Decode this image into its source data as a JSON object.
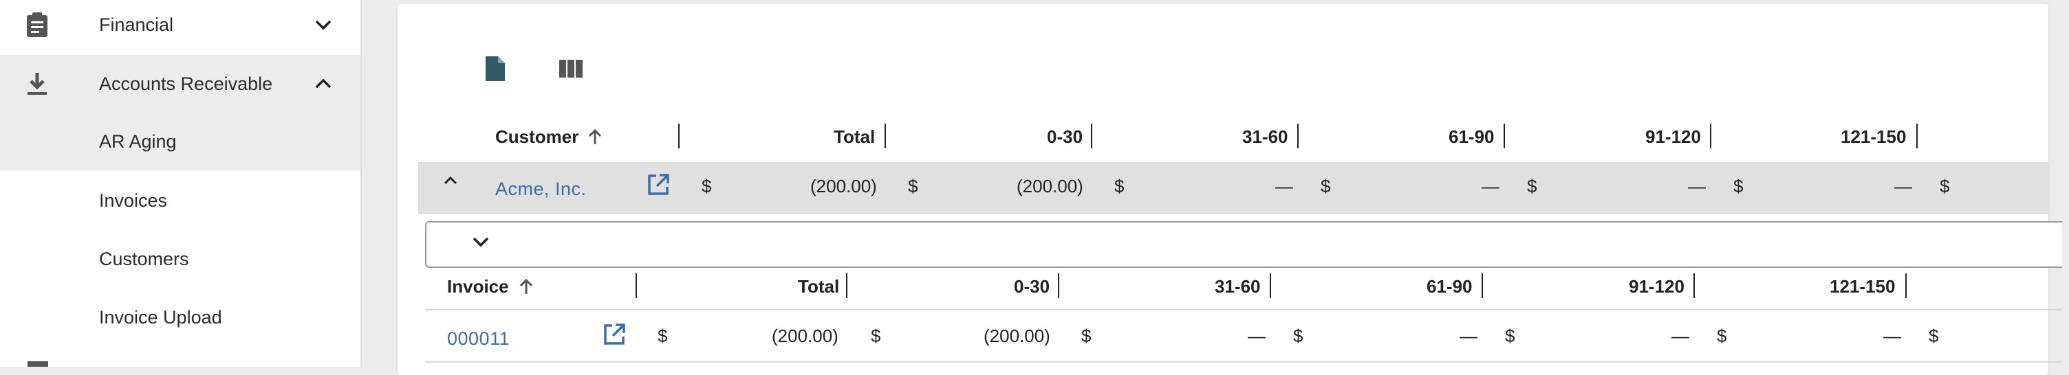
{
  "sidebar": {
    "items": [
      {
        "label": "Financial",
        "icon": "clipboard-icon",
        "expanded": false
      },
      {
        "label": "Accounts Receivable",
        "icon": "download-icon",
        "expanded": true
      },
      {
        "label": "AR Aging",
        "active": true
      },
      {
        "label": "Invoices"
      },
      {
        "label": "Customers"
      },
      {
        "label": "Invoice Upload"
      }
    ]
  },
  "toolbar": {
    "icons": [
      "document-icon",
      "columns-icon"
    ]
  },
  "customer_table": {
    "headers": [
      "Customer",
      "Total",
      "0-30",
      "31-60",
      "61-90",
      "91-120",
      "121-150"
    ],
    "row": {
      "name": "Acme, Inc.",
      "currency": "$",
      "total": "(200.00)",
      "d0_30": "(200.00)",
      "d31_60": "—",
      "d61_90": "—",
      "d91_120": "—",
      "d121_150": "—"
    }
  },
  "invoice_table": {
    "headers": [
      "Invoice",
      "Total",
      "0-30",
      "31-60",
      "61-90",
      "91-120",
      "121-150"
    ],
    "row": {
      "invoice": "000011",
      "currency": "$",
      "total": "(200.00)",
      "d0_30": "(200.00)",
      "d31_60": "—",
      "d61_90": "—",
      "d91_120": "—",
      "d121_150": "—"
    }
  },
  "colors": {
    "link": "#3a6ea5",
    "icon_dark": "#2f5b68",
    "sidebar_active": "#ececec",
    "row_highlight": "#e0e0e0"
  }
}
